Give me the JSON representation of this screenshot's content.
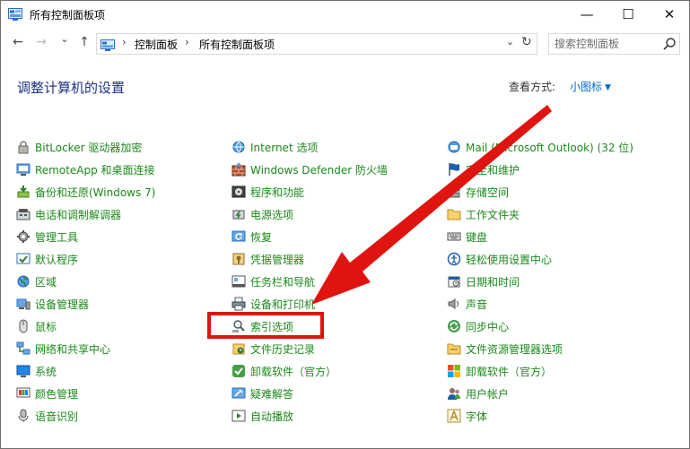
{
  "window": {
    "title": "所有控制面板项"
  },
  "address_bar": {
    "crumbs": [
      "控制面板",
      "所有控制面板项"
    ],
    "separator": "›"
  },
  "search": {
    "placeholder": "搜索控制面板"
  },
  "page": {
    "heading": "调整计算机的设置",
    "view_by_label": "查看方式:",
    "view_by_value": "小图标"
  },
  "icons": {
    "nav_back": "←",
    "nav_forward": "→",
    "nav_recent": "⌄",
    "nav_up": "↑",
    "minimize": "—",
    "maximize": "☐",
    "close": "✕",
    "dropdown": "⌄",
    "refresh": "↻"
  },
  "colors": {
    "link_green": "#1a8a1a",
    "heading_blue": "#1e3287",
    "highlight_red": "#e0140f"
  },
  "items": {
    "col1": [
      {
        "name": "bitlocker",
        "label": "BitLocker 驱动器加密"
      },
      {
        "name": "remoteapp",
        "label": "RemoteApp 和桌面连接"
      },
      {
        "name": "backup-restore",
        "label": "备份和还原(Windows 7)"
      },
      {
        "name": "phone-modem",
        "label": "电话和调制解调器"
      },
      {
        "name": "admin-tools",
        "label": "管理工具"
      },
      {
        "name": "default-programs",
        "label": "默认程序"
      },
      {
        "name": "region",
        "label": "区域"
      },
      {
        "name": "device-manager",
        "label": "设备管理器"
      },
      {
        "name": "mouse",
        "label": "鼠标"
      },
      {
        "name": "network-sharing",
        "label": "网络和共享中心"
      },
      {
        "name": "system",
        "label": "系统"
      },
      {
        "name": "color-management",
        "label": "颜色管理"
      },
      {
        "name": "speech-recognition",
        "label": "语音识别"
      }
    ],
    "col2": [
      {
        "name": "internet-options",
        "label": "Internet 选项"
      },
      {
        "name": "windows-defender",
        "label": "Windows Defender 防火墙"
      },
      {
        "name": "programs-features",
        "label": "程序和功能"
      },
      {
        "name": "power-options",
        "label": "电源选项"
      },
      {
        "name": "recovery",
        "label": "恢复"
      },
      {
        "name": "credential-manager",
        "label": "凭据管理器"
      },
      {
        "name": "taskbar-navigation",
        "label": "任务栏和导航"
      },
      {
        "name": "devices-printers",
        "label": "设备和打印机"
      },
      {
        "name": "indexing-options",
        "label": "索引选项"
      },
      {
        "name": "file-history",
        "label": "文件历史记录"
      },
      {
        "name": "uninstall-software-2",
        "label": "卸载软件（官方）"
      },
      {
        "name": "troubleshooting",
        "label": "疑难解答"
      },
      {
        "name": "autoplay",
        "label": "自动播放"
      }
    ],
    "col3": [
      {
        "name": "mail",
        "label": "Mail (Microsoft Outlook) (32 位)"
      },
      {
        "name": "security-maintenance",
        "label": "安全和维护"
      },
      {
        "name": "storage-spaces",
        "label": "存储空间"
      },
      {
        "name": "work-folders",
        "label": "工作文件夹"
      },
      {
        "name": "keyboard",
        "label": "键盘"
      },
      {
        "name": "ease-of-access",
        "label": "轻松使用设置中心"
      },
      {
        "name": "date-time",
        "label": "日期和时间"
      },
      {
        "name": "sound",
        "label": "声音"
      },
      {
        "name": "sync-center",
        "label": "同步中心"
      },
      {
        "name": "file-explorer-options",
        "label": "文件资源管理器选项"
      },
      {
        "name": "uninstall-software-3",
        "label": "卸载软件（官方）"
      },
      {
        "name": "user-accounts",
        "label": "用户帐户"
      },
      {
        "name": "fonts",
        "label": "字体"
      }
    ]
  }
}
